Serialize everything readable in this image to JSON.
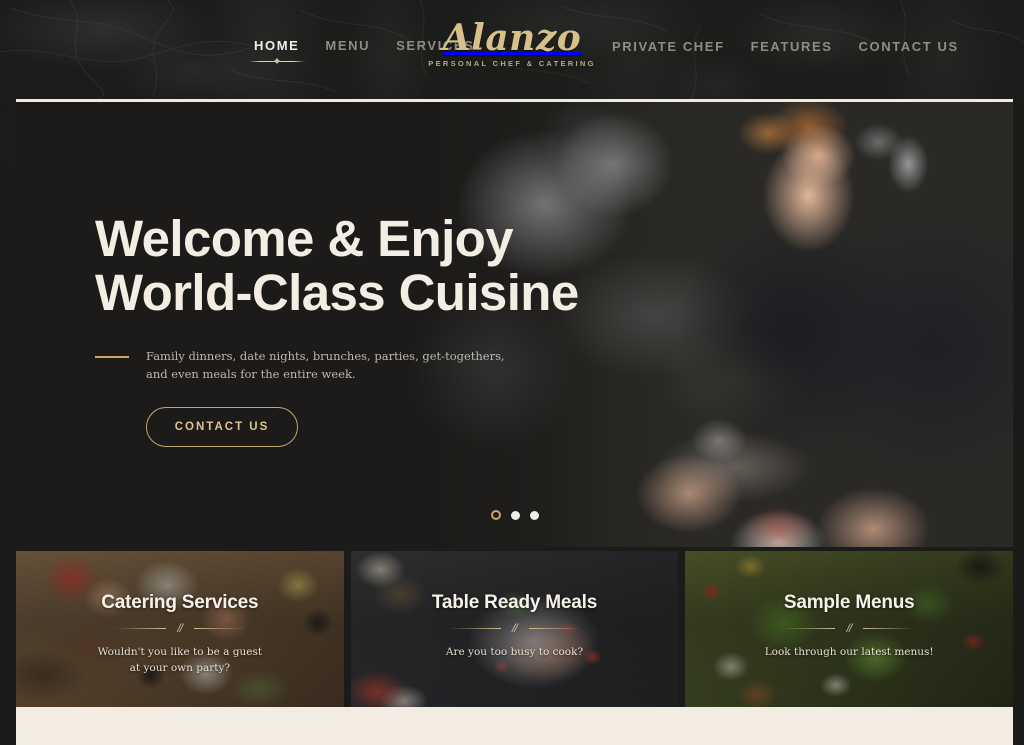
{
  "site": {
    "brand_name": "Alanzo",
    "brand_tagline": "PERSONAL CHEF & CATERING",
    "accent_gold": "#C5A865",
    "cream": "#F3EDE3",
    "dark": "#1c1c1a"
  },
  "nav": {
    "left_items": [
      {
        "label": "HOME",
        "active": true
      },
      {
        "label": "MENU",
        "active": false
      },
      {
        "label": "SERVICES",
        "active": false
      }
    ],
    "right_items": [
      {
        "label": "PRIVATE CHEF",
        "active": false
      },
      {
        "label": "FEATURES",
        "active": false
      },
      {
        "label": "CONTACT US",
        "active": false
      }
    ]
  },
  "hero": {
    "heading_line1": "Welcome & Enjoy",
    "heading_line2": "World-Class Cuisine",
    "subtitle_line1": "Family dinners, date nights, brunches, parties, get-togethers,",
    "subtitle_line2": "and even meals for the entire week.",
    "cta_label": "CONTACT US",
    "slides_total": 3,
    "active_slide": 1,
    "image_alt": "chef plating a dish in a kitchen"
  },
  "cards": [
    {
      "title": "Catering Services",
      "text_line1": "Wouldn't you like to be a guest",
      "text_line2": "at your own party?",
      "divider_ornament": "//",
      "image_alt": "shrimp canapes on a wooden board with lemon and olives"
    },
    {
      "title": "Table Ready Meals",
      "text_line1": "Are you too busy to cook?",
      "text_line2": "",
      "divider_ornament": "//",
      "image_alt": "penne pasta with tomato sauce and basil on a plate"
    },
    {
      "title": "Sample Menus",
      "text_line1": "Look through our latest menus!",
      "text_line2": "",
      "divider_ornament": "//",
      "image_alt": "fresh green salad with broccoli and vegetables"
    }
  ]
}
